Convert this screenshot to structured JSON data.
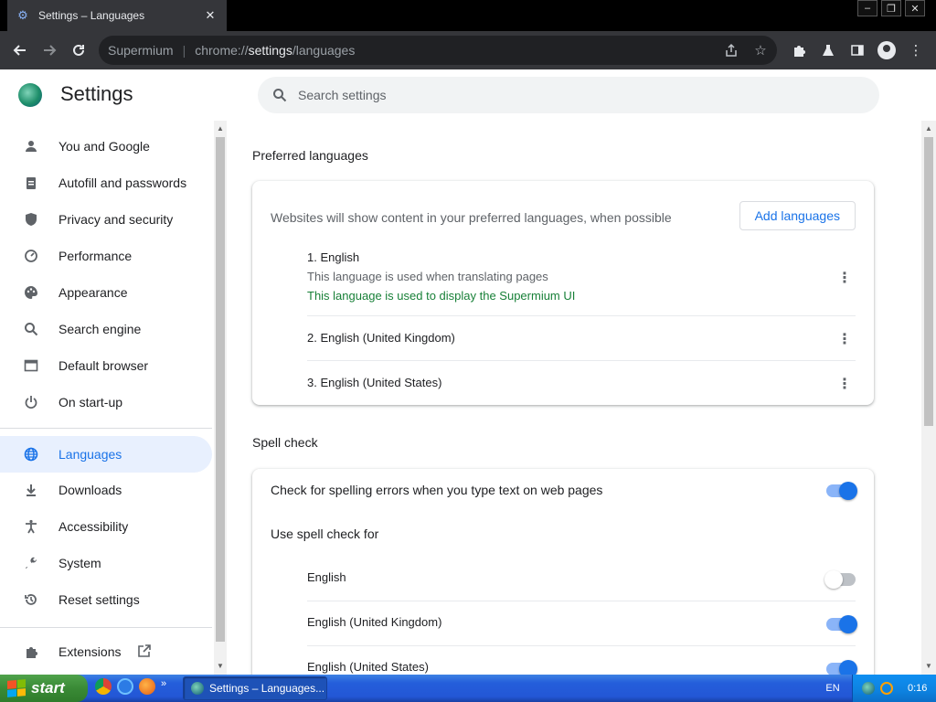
{
  "browser": {
    "tab_title": "Settings – Languages",
    "tab_close": "✕",
    "window_buttons": [
      "‒",
      "❐",
      "✕"
    ],
    "omnibox_brand": "Supermium",
    "omnibox_scheme": "chrome://",
    "omnibox_host": "settings",
    "omnibox_path": "/languages"
  },
  "header": {
    "title": "Settings",
    "search_placeholder": "Search settings"
  },
  "sidebar": {
    "items": [
      {
        "label": "You and Google",
        "icon": "person-icon"
      },
      {
        "label": "Autofill and passwords",
        "icon": "clipboard-icon"
      },
      {
        "label": "Privacy and security",
        "icon": "shield-icon"
      },
      {
        "label": "Performance",
        "icon": "speedometer-icon"
      },
      {
        "label": "Appearance",
        "icon": "palette-icon"
      },
      {
        "label": "Search engine",
        "icon": "search-icon"
      },
      {
        "label": "Default browser",
        "icon": "browser-icon"
      },
      {
        "label": "On start-up",
        "icon": "power-icon"
      },
      {
        "label": "Languages",
        "icon": "globe-icon",
        "active": true
      },
      {
        "label": "Downloads",
        "icon": "download-icon"
      },
      {
        "label": "Accessibility",
        "icon": "accessibility-icon"
      },
      {
        "label": "System",
        "icon": "wrench-icon"
      },
      {
        "label": "Reset settings",
        "icon": "history-icon"
      },
      {
        "label": "Extensions",
        "icon": "puzzle-icon"
      }
    ]
  },
  "preferred": {
    "title": "Preferred languages",
    "description": "Websites will show content in your preferred languages, when possible",
    "add_button": "Add languages",
    "languages": [
      {
        "name": "1. English",
        "sub": "This language is used when translating pages",
        "sub_green": "This language is used to display the Supermium UI"
      },
      {
        "name": "2. English (United Kingdom)"
      },
      {
        "name": "3. English (United States)"
      }
    ]
  },
  "spellcheck": {
    "title": "Spell check",
    "check_label": "Check for spelling errors when you type text on web pages",
    "check_enabled": true,
    "use_for_label": "Use spell check for",
    "languages": [
      {
        "name": "English",
        "enabled": false
      },
      {
        "name": "English (United Kingdom)",
        "enabled": true
      },
      {
        "name": "English (United States)",
        "enabled": true
      }
    ]
  },
  "taskbar": {
    "start_label": "start",
    "task_label": "Settings – Languages...",
    "language_indicator": "EN",
    "clock": "0:16"
  },
  "colors": {
    "accent": "#1a73e8",
    "green_text": "#188038",
    "active_nav_bg": "#e8f0fe"
  }
}
